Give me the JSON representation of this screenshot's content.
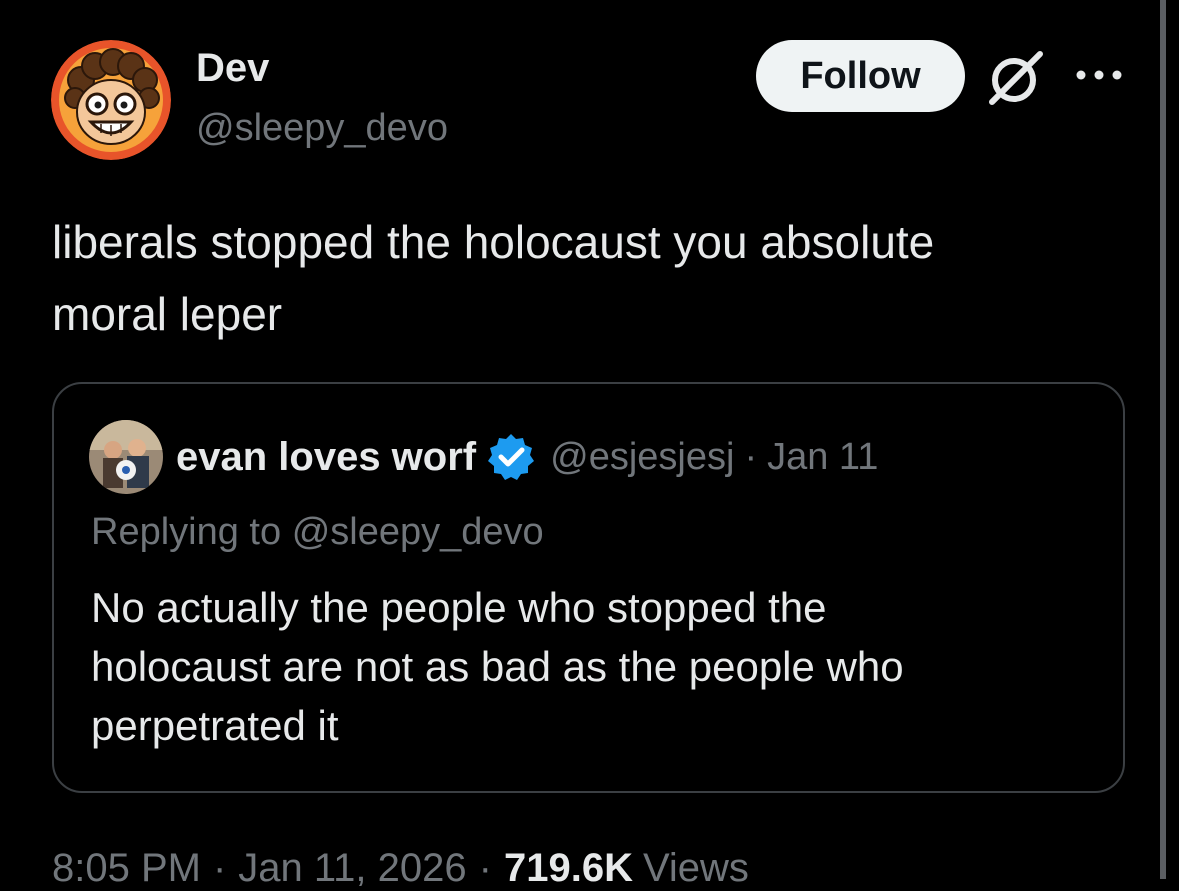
{
  "tweet": {
    "author": {
      "name": "Dev",
      "handle": "@sleepy_devo"
    },
    "follow_label": "Follow",
    "text_lines": [
      "liberals stopped the holocaust you absolute",
      "moral leper"
    ],
    "quote": {
      "author_name": "evan loves worf",
      "verified": true,
      "handle": "@esjesjesj",
      "separator": "·",
      "date": "Jan 11",
      "replying_prefix": "Replying to",
      "replying_handle": "@sleepy_devo",
      "text_lines": [
        "No actually the people who stopped the",
        "holocaust are not as bad as the people who",
        "perpetrated it"
      ]
    },
    "meta": {
      "time": "8:05 PM",
      "separator": "·",
      "date": "Jan 11, 2026",
      "views_count": "719.6K",
      "views_label": "Views"
    }
  },
  "icons": {
    "grok": "grok-icon",
    "more": "more-options-icon",
    "verified": "verified-badge-icon"
  },
  "colors": {
    "background": "#000000",
    "text_primary": "#e7e9ea",
    "text_secondary": "#71767b",
    "follow_bg": "#eff3f4",
    "verified_blue": "#1d9bf0",
    "card_border": "#3b3f43"
  }
}
